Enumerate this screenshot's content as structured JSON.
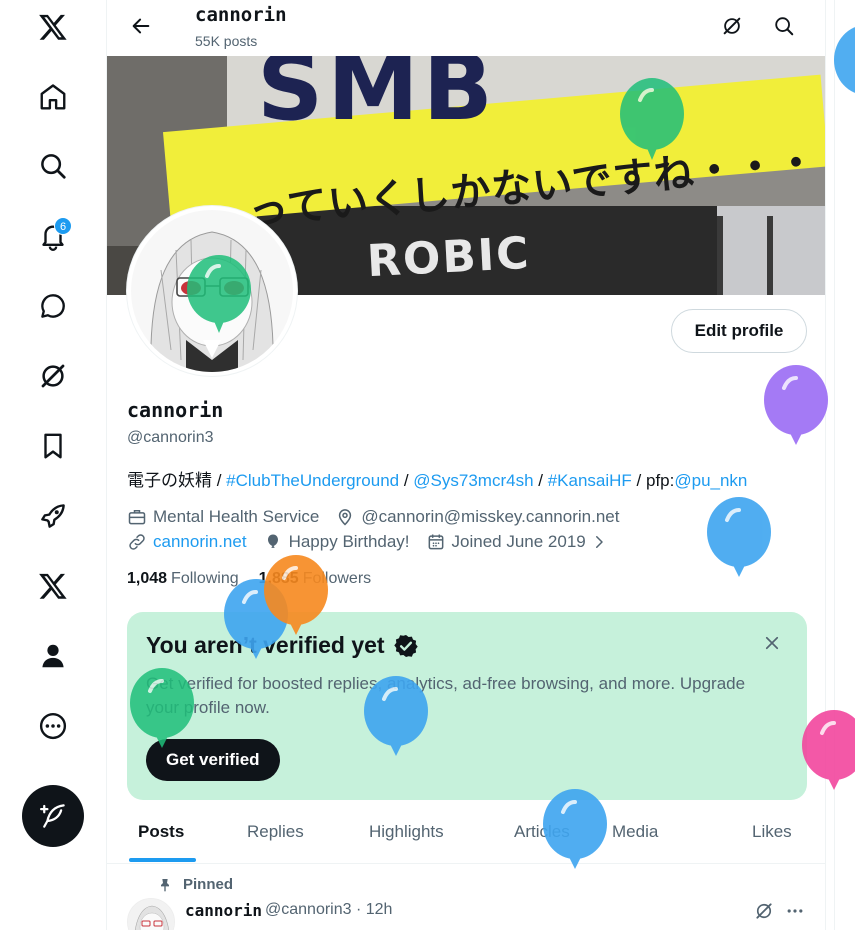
{
  "nav": {
    "items": [
      {
        "icon": "x-logo-icon"
      },
      {
        "icon": "home-icon"
      },
      {
        "icon": "search-icon"
      },
      {
        "icon": "bell-icon",
        "badge": "6"
      },
      {
        "icon": "message-icon"
      },
      {
        "icon": "grok-icon"
      },
      {
        "icon": "bookmark-icon"
      },
      {
        "icon": "rocket-icon"
      },
      {
        "icon": "x-premium-icon"
      },
      {
        "icon": "profile-icon"
      },
      {
        "icon": "more-icon"
      }
    ],
    "compose_icon": "compose-icon"
  },
  "header": {
    "name": "cannorin",
    "posts_count": "55K posts"
  },
  "banner": {
    "sign_text": "SMB",
    "jp_text": "っていくしかないですね・・・",
    "lower_text": "ROBIC"
  },
  "profile": {
    "edit_label": "Edit profile",
    "display_name": "cannorin",
    "handle": "@cannorin3",
    "bio": {
      "prefix": "電子の妖精 / ",
      "tag1": "#ClubTheUnderground",
      "sep1": " / ",
      "mention1": "@Sys73mcr4sh",
      "sep2": " / ",
      "tag2": "#KansaiHF",
      "sep3": " / pfp:",
      "mention2": "@pu_nkn"
    },
    "category": "Mental Health Service",
    "location": "@cannorin@misskey.cannorin.net",
    "website": "cannorin.net",
    "birthday": "Happy Birthday!",
    "joined": "Joined June 2019",
    "following_count": "1,048",
    "following_label": "Following",
    "followers_count": "1,885",
    "followers_label": "Followers"
  },
  "verify_card": {
    "title": "You aren’t verified yet",
    "description": "Get verified for boosted replies, analytics, ad-free browsing, and more. Upgrade your profile now.",
    "button": "Get verified",
    "bg_color": "#c6f1db"
  },
  "tabs": [
    {
      "label": "Posts",
      "active": true
    },
    {
      "label": "Replies"
    },
    {
      "label": "Highlights"
    },
    {
      "label": "Articles"
    },
    {
      "label": "Media"
    },
    {
      "label": "Likes"
    }
  ],
  "pinned_post": {
    "pinned_label": "Pinned",
    "author": "cannorin",
    "meta": "@cannorin3 · 12h"
  },
  "colors": {
    "accent": "#1d9bf0",
    "text": "#0f1419",
    "muted": "#536471"
  }
}
